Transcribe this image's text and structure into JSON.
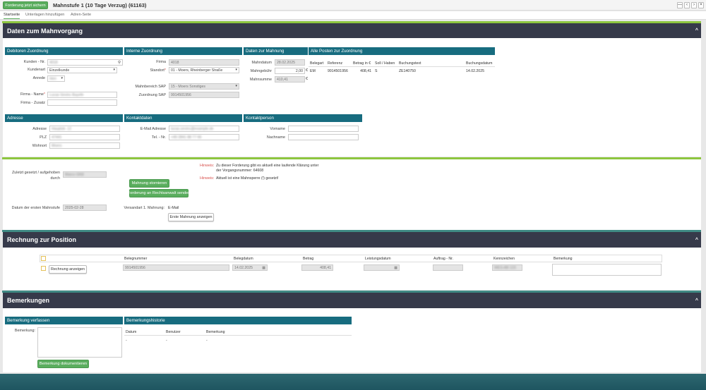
{
  "toolbar": {
    "save_label": "Forderung jetzt sichern",
    "title": "Mahnstufe 1 (10 Tage Verzug) (61163)",
    "btn_minimize": "—",
    "btn_prev": "‹",
    "btn_next": "›",
    "btn_close": "×"
  },
  "tabs": [
    "Startseite",
    "Unterlagen hinzufügen",
    "Adren-Seite"
  ],
  "section1": {
    "title": "Daten zum Mahnvorgang",
    "debitoren": {
      "title": "Debitoren Zuordnung",
      "kunden_nr_label": "Kunden - Nr.",
      "kunden_nr": "4018",
      "kundenart_label": "Kundenart",
      "kundenart": "Einzelkunde",
      "anrede_label": "Anrede",
      "anrede": "Herr",
      "firma_name_label": "Firma - Name",
      "firma_name": "Lucas Sevinc Bayefe",
      "firma_zusatz_label": "Firma - Zusatz",
      "firma_zusatz": ""
    },
    "intern": {
      "title": "Interne Zuordnung",
      "firma_label": "Firma",
      "firma": "4018",
      "standort_label": "Standort",
      "standort": "01 - Moers, Rheinberger Straße",
      "mahnbereich_label": "Mahnbereich SAP",
      "mahnbereich": "15 - Moers Sonstiges",
      "zuordnung_label": "Zuordnung SAP",
      "zuordnung": "9914501956"
    },
    "mahnung": {
      "title": "Daten zur Mahnung",
      "mahndatum_label": "Mahndatum",
      "mahndatum": "28.02.2025",
      "mahngebuehr_label": "Mahngebühr",
      "mahngebuehr": "2,00",
      "mahnsumme_label": "Mahnsumme",
      "mahnsumme": "410,41",
      "currency": "€"
    },
    "posten": {
      "title": "Alle Posten zur Zuordnung",
      "headers": [
        "Belegart",
        "Referenz",
        "Betrag in €",
        "Soll / Haben",
        "Buchungstext",
        "Buchungsdatum"
      ],
      "row": [
        "EM",
        "9914501956",
        "408,41",
        "S",
        "ZE140750",
        "14.02.2025"
      ]
    },
    "adresse": {
      "title": "Adresse",
      "adresse_label": "Adresse",
      "adresse": "Hauptstr. 12",
      "plz_label": "PLZ",
      "plz": "47441",
      "wohnort_label": "Wohnort",
      "wohnort": "Moers"
    },
    "kontakt": {
      "title": "Kontaktdaten",
      "email_label": "E-Mail Adresse",
      "email": "lucas.sevinc@example.de",
      "tel_label": "Tel. - Nr.",
      "tel": "+49 2841 88 77 66"
    },
    "person": {
      "title": "Kontaktperson",
      "vorname_label": "Vorname",
      "vorname": "",
      "nachname_label": "Nachname",
      "nachname": ""
    }
  },
  "mid": {
    "zuletzt_label": "Zuletzt gesetzt / aufgehoben durch",
    "zuletzt": "Marco Gföll",
    "storno_label": "Mahnung stornieren",
    "rechtsanwalt_label": "Forderung an Rechtsanwalt senden",
    "datum_label": "Datum der ersten Mahnstufe",
    "datum": "2025-02-28",
    "versand_label": "Versandart 1. Mahnung:",
    "versand": "E-Mail",
    "erste_label": "Erste Mahnung anzeigen",
    "hinweis_label": "Hinweis:",
    "hinweis1": "Zu dieser Forderung gibt es aktuell eine laufende Klärung unter der Vorgangsnummer: 64608",
    "hinweis2": "Aktuell ist eine Mahnsperre (!) gesetzt!"
  },
  "section2": {
    "title": "Rechnung zur Position",
    "headers": [
      "Belegnummer",
      "Belegdatum",
      "Betrag",
      "Leistungsdatum",
      "Auftrag - Nr.",
      "Kennzeichen",
      "Bemerkung"
    ],
    "anzeigen_label": "Rechnung anzeigen",
    "belegnummer": "9914501956",
    "belegdatum": "14.02.2025",
    "betrag": "408,41",
    "kennzeichen": "WES-AB 123"
  },
  "section3": {
    "title": "Bemerkungen",
    "verfassen_title": "Bemerkung verfassen",
    "bemerkung_label": "Bemerkung:",
    "dokumentieren_label": "Bemerkung dokumentieren",
    "historie_title": "Bemerkungshistorie",
    "headers": [
      "Datum",
      "Benutzer",
      "Bemerkung"
    ],
    "row": [
      "-",
      "-",
      "-"
    ]
  }
}
